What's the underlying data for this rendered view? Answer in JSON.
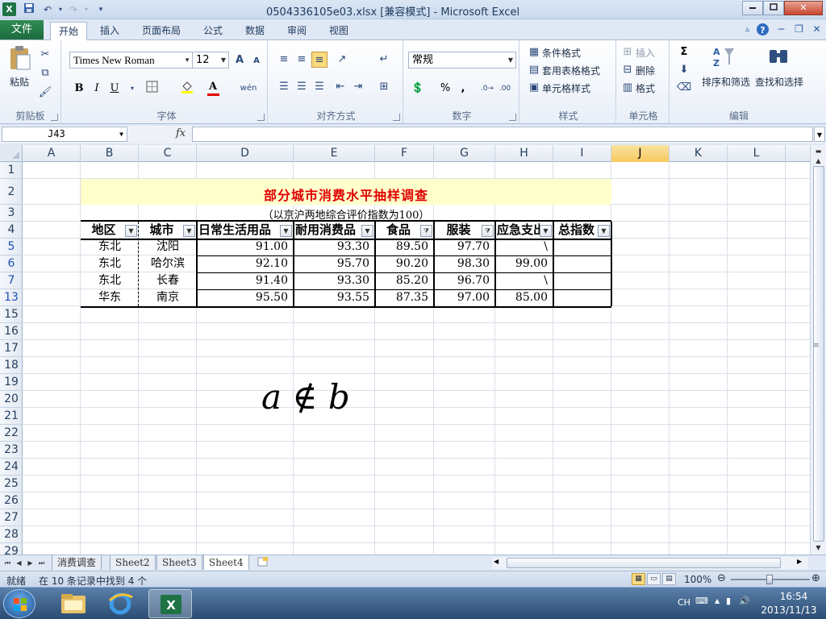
{
  "window": {
    "title": "0504336105e03.xlsx  [兼容模式]  -  Microsoft Excel",
    "app_icon": "X"
  },
  "ribbon_tabs": {
    "file": "文件",
    "items": [
      "开始",
      "插入",
      "页面布局",
      "公式",
      "数据",
      "审阅",
      "视图"
    ],
    "active": "开始"
  },
  "ribbon": {
    "clipboard": {
      "label": "剪贴板",
      "paste": "粘贴"
    },
    "font": {
      "label": "字体",
      "family": "Times New Roman",
      "size": "12",
      "bold": "B",
      "italic": "I",
      "underline": "U",
      "grow": "A",
      "shrink": "A",
      "color_letter": "A",
      "phonetic": "wén"
    },
    "alignment": {
      "label": "对齐方式"
    },
    "number": {
      "label": "数字",
      "format": "常规",
      "percent": "%",
      "comma": ","
    },
    "styles": {
      "label": "样式",
      "conditional": "条件格式",
      "table": "套用表格格式",
      "cell_styles": "单元格样式"
    },
    "cells": {
      "label": "单元格",
      "insert": "插入",
      "delete": "删除",
      "format": "格式"
    },
    "editing": {
      "label": "编辑",
      "sum": "Σ",
      "sort": "排序和筛选",
      "find": "查找和选择"
    }
  },
  "formula_bar": {
    "name_box": "J43",
    "fx": "fx",
    "formula": ""
  },
  "grid": {
    "columns": [
      "A",
      "B",
      "C",
      "D",
      "E",
      "F",
      "G",
      "H",
      "I",
      "J",
      "K",
      "L"
    ],
    "selected_column": "J",
    "rows": [
      "1",
      "2",
      "3",
      "4",
      "5",
      "6",
      "7",
      "13",
      "15",
      "16",
      "17",
      "18",
      "19",
      "20",
      "21",
      "22",
      "23",
      "24",
      "25",
      "26",
      "27",
      "28",
      "29"
    ],
    "filtered_rows": [
      "5",
      "6",
      "7",
      "13"
    ]
  },
  "sheet": {
    "title": "部分城市消费水平抽样调查",
    "subtitle": "（以京沪两地综合评价指数为100）",
    "headers": [
      "地区",
      "城市",
      "日常生活用品",
      "耐用消费品",
      "食品",
      "服装",
      "应急支出",
      "总指数"
    ],
    "rows": [
      [
        "东北",
        "沈阳",
        "91.00",
        "93.30",
        "89.50",
        "97.70",
        "\\",
        ""
      ],
      [
        "东北",
        "哈尔滨",
        "92.10",
        "95.70",
        "90.20",
        "98.30",
        "99.00",
        ""
      ],
      [
        "东北",
        "长春",
        "91.40",
        "93.30",
        "85.20",
        "96.70",
        "\\",
        ""
      ],
      [
        "华东",
        "南京",
        "95.50",
        "93.55",
        "87.35",
        "97.00",
        "85.00",
        ""
      ]
    ],
    "math_object": "a ∉ b"
  },
  "sheet_tabs": {
    "items": [
      "消费调查",
      "Sheet2",
      "Sheet3",
      "Sheet4"
    ],
    "active": "Sheet4"
  },
  "status_bar": {
    "ready": "就绪",
    "filter_message": "在 10 条记录中找到 4 个",
    "zoom": "100%"
  },
  "taskbar": {
    "ime": "CH",
    "time": "16:54",
    "date": "2013/11/13"
  }
}
